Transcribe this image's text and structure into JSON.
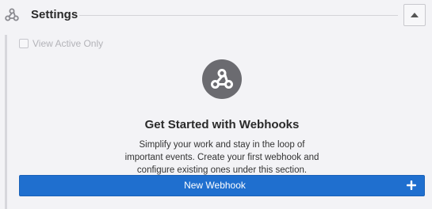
{
  "header": {
    "title": "Settings",
    "icon": "webhook-icon",
    "collapse_icon": "triangle-up-icon"
  },
  "filters": {
    "view_active_only_label": "View Active Only",
    "view_active_only_checked": false
  },
  "empty_state": {
    "icon": "webhook-icon",
    "title": "Get Started with Webhooks",
    "description": "Simplify your work and stay in the loop of important events. Create your first webhook and configure existing ones under this section."
  },
  "actions": {
    "new_webhook_label": "New Webhook",
    "new_webhook_icon": "plus-icon"
  },
  "colors": {
    "primary": "#1f6fcf",
    "icon_gray": "#6b6b70",
    "background": "#f3f3f6"
  }
}
